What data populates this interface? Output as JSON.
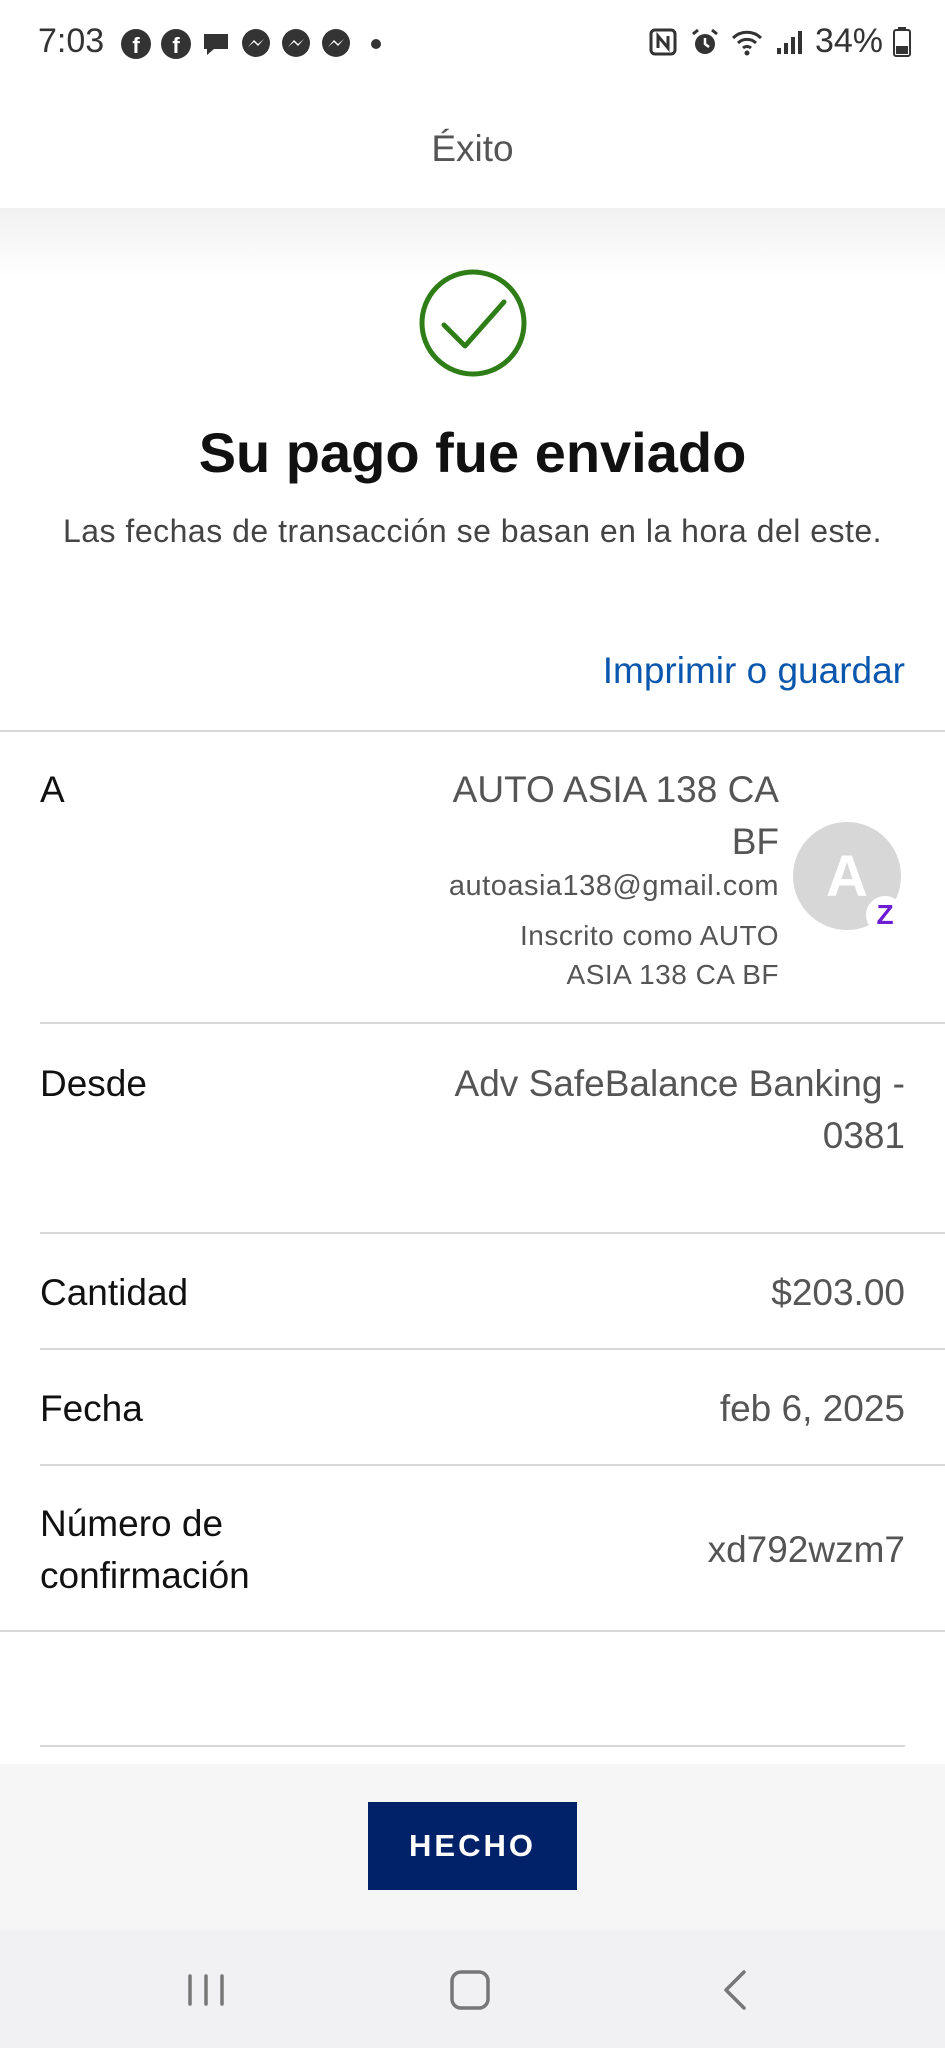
{
  "status_bar": {
    "time": "7:03",
    "battery": "34%"
  },
  "header": {
    "title": "Éxito"
  },
  "confirmation": {
    "title": "Su pago fue enviado",
    "subtitle": "Las fechas de transacción se basan en la hora del este.",
    "print_link": "Imprimir o guardar"
  },
  "details": {
    "to": {
      "label": "A",
      "name": "AUTO ASIA 138 CA BF",
      "email": "autoasia138@gmail.com",
      "enrolled": "Inscrito como AUTO ASIA 138 CA BF",
      "avatar_letter": "A",
      "badge": "Z"
    },
    "from": {
      "label": "Desde",
      "value": "Adv SafeBalance Banking - 0381"
    },
    "amount": {
      "label": "Cantidad",
      "value": "$203.00"
    },
    "date": {
      "label": "Fecha",
      "value": "feb 6, 2025"
    },
    "confirmation_number": {
      "label": "Número de confirmación",
      "value": "xd792wzm7"
    }
  },
  "footer": {
    "done_label": "HECHO"
  },
  "colors": {
    "accent": "#012169",
    "link": "#0b57ad",
    "success": "#2e7d16",
    "zelle": "#6d1ed4"
  }
}
